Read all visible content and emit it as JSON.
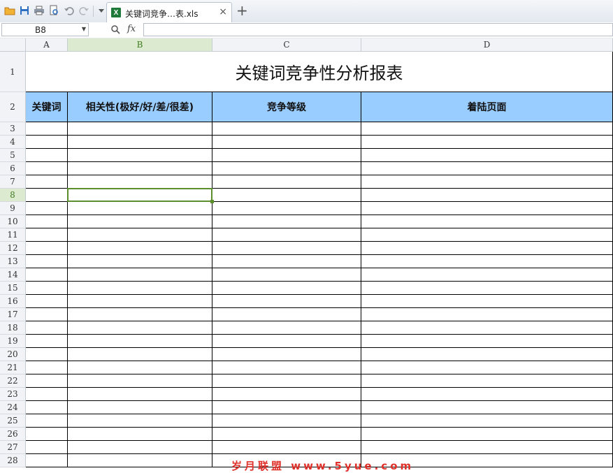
{
  "toolbar": {
    "icons": [
      "open-folder-icon",
      "save-icon",
      "print-icon",
      "print-preview-icon",
      "undo-icon",
      "redo-icon",
      "customize-dropdown-icon"
    ]
  },
  "tab": {
    "label": "关键词竞争…表.xls",
    "close_glyph": "×",
    "add_glyph": "+"
  },
  "formula_bar": {
    "cell_ref": "B8",
    "fx_label": "fx",
    "formula": ""
  },
  "sheet": {
    "columns": [
      "A",
      "B",
      "C",
      "D"
    ],
    "rows": [
      "1",
      "2",
      "3",
      "4",
      "5",
      "6",
      "7",
      "8",
      "9",
      "10",
      "11",
      "12",
      "13",
      "14",
      "15",
      "16",
      "17",
      "18",
      "19",
      "20",
      "21",
      "22",
      "23",
      "24",
      "25",
      "26",
      "27",
      "28"
    ],
    "selected_column": "B",
    "selected_row": "8",
    "title": "关键词竞争性分析报表",
    "headers": [
      "关键词",
      "相关性(极好/好/差/很差)",
      "竞争等级",
      "着陆页面"
    ]
  },
  "colors": {
    "header_fill": "#99ccff",
    "selection": "#5a8f2b",
    "watermark": "#e0312b"
  },
  "watermark": "岁月联盟 www.5yue.com"
}
